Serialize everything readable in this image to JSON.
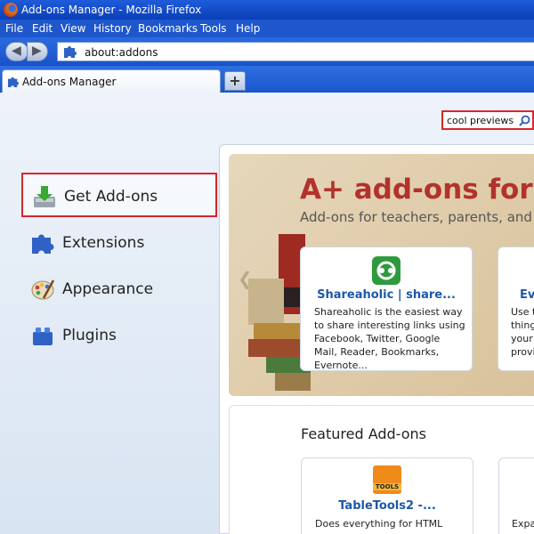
{
  "window": {
    "title": "Add-ons Manager - Mozilla Firefox"
  },
  "menu": [
    {
      "label": "File"
    },
    {
      "label": "Edit"
    },
    {
      "label": "View"
    },
    {
      "label": "History"
    },
    {
      "label": "Bookmarks"
    },
    {
      "label": "Tools"
    },
    {
      "label": "Help"
    }
  ],
  "nav": {
    "url": "about:addons"
  },
  "tab": {
    "label": "Add-ons Manager",
    "new_tab": "+"
  },
  "search": {
    "value": "cool previews"
  },
  "sidebar": {
    "items": [
      {
        "label": "Get Add-ons"
      },
      {
        "label": "Extensions"
      },
      {
        "label": "Appearance"
      },
      {
        "label": "Plugins"
      }
    ]
  },
  "spotlight": {
    "title": "A+ add-ons for",
    "subtitle": "Add-ons for teachers, parents, and st",
    "card1": {
      "name": "Shareaholic | share...",
      "description": "Shareaholic is the easiest way to share interesting links using Facebook, Twitter, Google Mail, Reader, Bookmarks, Evernote..."
    },
    "card2": {
      "name": "Ev",
      "description": "Use t thing your provi"
    }
  },
  "featured": {
    "title": "Featured Add-ons",
    "card1": {
      "name": "TableTools2 -...",
      "icon_text": "TOOLS",
      "description": "Does everything for HTML"
    },
    "card2": {
      "description": "Expa"
    }
  },
  "colors": {
    "accent": "#1e57cc",
    "highlight": "#d7262b",
    "link": "#1c58a8",
    "spotlight_title": "#b3322c"
  }
}
